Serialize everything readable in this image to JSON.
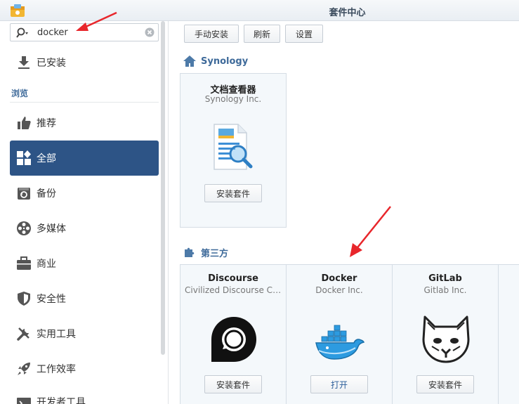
{
  "window": {
    "title": "套件中心"
  },
  "search": {
    "value": "docker",
    "placeholder": ""
  },
  "sidebar": {
    "installed_label": "已安装",
    "browse_section": "浏览",
    "items": [
      {
        "label": "推荐",
        "icon": "thumbs-up-icon"
      },
      {
        "label": "全部",
        "icon": "all-grid-icon",
        "active": true
      },
      {
        "label": "备份",
        "icon": "backup-icon"
      },
      {
        "label": "多媒体",
        "icon": "film-reel-icon"
      },
      {
        "label": "商业",
        "icon": "briefcase-icon"
      },
      {
        "label": "安全性",
        "icon": "shield-icon"
      },
      {
        "label": "实用工具",
        "icon": "tools-icon"
      },
      {
        "label": "工作效率",
        "icon": "rocket-icon"
      },
      {
        "label": "开发者工具",
        "icon": "developer-icon"
      }
    ]
  },
  "toolbar": {
    "manual_install": "手动安装",
    "refresh": "刷新",
    "settings": "设置"
  },
  "groups": {
    "synology": {
      "title": "Synology",
      "packages": [
        {
          "name": "文档查看器",
          "vendor": "Synology Inc.",
          "action": "安装套件",
          "icon": "document-viewer-icon"
        }
      ]
    },
    "third_party": {
      "title": "第三方",
      "packages": [
        {
          "name": "Discourse",
          "vendor": "Civilized Discourse Construction Kit, Inc.",
          "action": "安装套件",
          "icon": "discourse-logo-icon"
        },
        {
          "name": "Docker",
          "vendor": "Docker Inc.",
          "action": "打开",
          "icon": "docker-whale-icon"
        },
        {
          "name": "GitLab",
          "vendor": "Gitlab Inc.",
          "action": "安装套件",
          "icon": "gitlab-fox-icon"
        }
      ]
    }
  },
  "colors": {
    "accent": "#2d5486",
    "section_text": "#3e6a9a",
    "arrow": "#e8262b"
  }
}
